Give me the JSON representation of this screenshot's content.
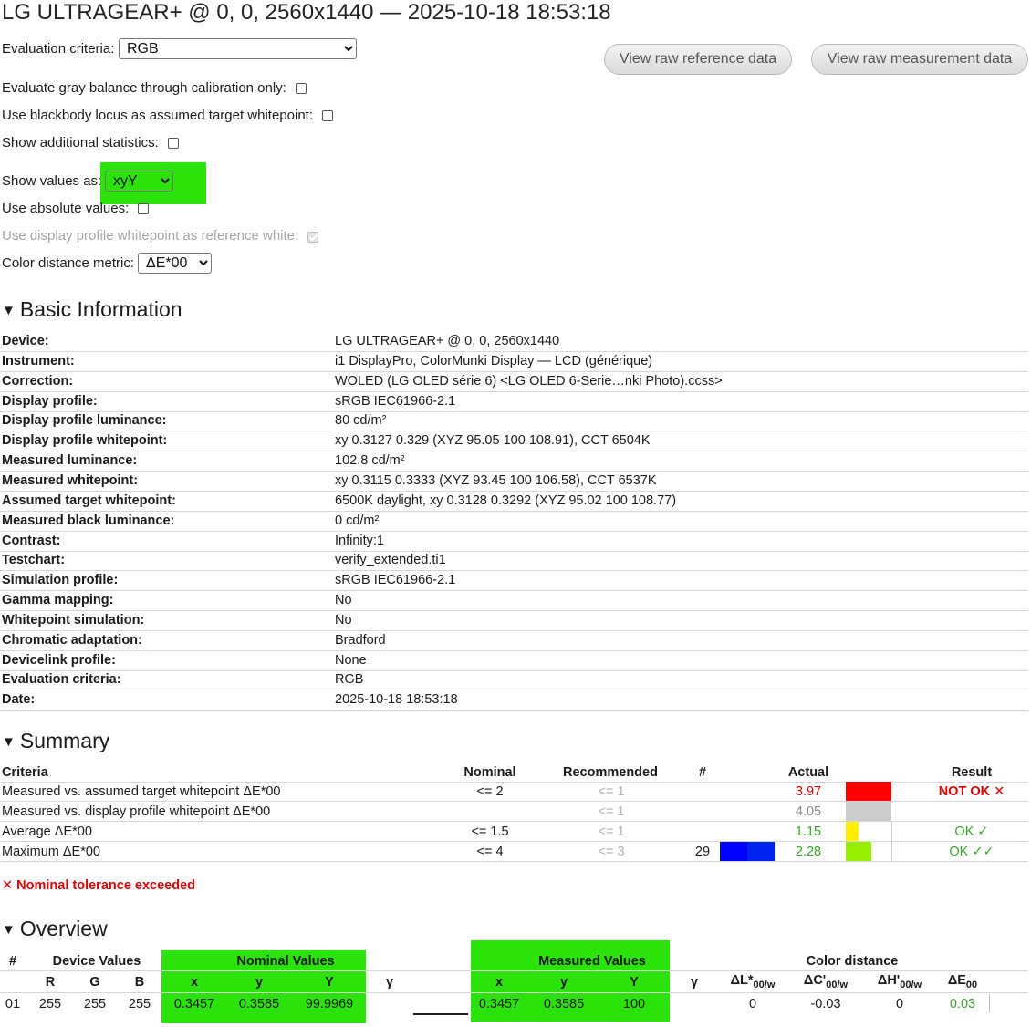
{
  "page": {
    "title": "LG ULTRAGEAR+ @ 0, 0, 2560x1440 — 2025-10-18 18:53:18"
  },
  "controls": {
    "evaluation_criteria": {
      "label": "Evaluation criteria:",
      "value": "RGB"
    },
    "view_raw_reference": "View raw reference data",
    "view_raw_measurement": "View raw measurement data",
    "gray_balance": {
      "label": "Evaluate gray balance through calibration only:",
      "checked": false
    },
    "blackbody": {
      "label": "Use blackbody locus as assumed target whitepoint:",
      "checked": false
    },
    "additional_stats": {
      "label": "Show additional statistics:",
      "checked": false
    },
    "show_values_as": {
      "label": "Show values as:",
      "value": "xyY"
    },
    "absolute_values": {
      "label": "Use absolute values:",
      "checked": false
    },
    "display_profile_whitepoint": {
      "label": "Use display profile whitepoint as reference white:",
      "checked": true,
      "disabled": true
    },
    "color_distance_metric": {
      "label": "Color distance metric:",
      "value": "ΔE*00"
    }
  },
  "basic_info": {
    "heading": "Basic Information",
    "rows": [
      {
        "key": "Device:",
        "value": "LG ULTRAGEAR+ @ 0, 0, 2560x1440"
      },
      {
        "key": "Instrument:",
        "value": "i1 DisplayPro, ColorMunki Display — LCD (générique)"
      },
      {
        "key": "Correction:",
        "value": "WOLED (LG OLED série 6) <LG OLED 6-Serie…nki Photo).ccss>"
      },
      {
        "key": "Display profile:",
        "value": "sRGB IEC61966-2.1"
      },
      {
        "key": "Display profile luminance:",
        "value": "80 cd/m²"
      },
      {
        "key": "Display profile whitepoint:",
        "value": "xy 0.3127 0.329 (XYZ 95.05 100 108.91), CCT 6504K"
      },
      {
        "key": "Measured luminance:",
        "value": "102.8 cd/m²"
      },
      {
        "key": "Measured whitepoint:",
        "value": "xy 0.3115 0.3333 (XYZ 93.45 100 106.58), CCT 6537K"
      },
      {
        "key": "Assumed target whitepoint:",
        "value": "6500K daylight, xy 0.3128 0.3292 (XYZ 95.02 100 108.77)"
      },
      {
        "key": "Measured black luminance:",
        "value": "0 cd/m²"
      },
      {
        "key": "Contrast:",
        "value": "Infinity:1"
      },
      {
        "key": "Testchart:",
        "value": "verify_extended.ti1"
      },
      {
        "key": "Simulation profile:",
        "value": "sRGB IEC61966-2.1"
      },
      {
        "key": "Gamma mapping:",
        "value": "No"
      },
      {
        "key": "Whitepoint simulation:",
        "value": "No"
      },
      {
        "key": "Chromatic adaptation:",
        "value": "Bradford"
      },
      {
        "key": "Devicelink profile:",
        "value": "None"
      },
      {
        "key": "Evaluation criteria:",
        "value": "RGB"
      },
      {
        "key": "Date:",
        "value": "2025-10-18 18:53:18"
      }
    ]
  },
  "summary": {
    "heading": "Summary",
    "headers": {
      "criteria": "Criteria",
      "nominal": "Nominal",
      "recommended": "Recommended",
      "count": "#",
      "actual": "Actual",
      "result": "Result"
    },
    "rows": [
      {
        "criteria": "Measured vs. assumed target whitepoint ΔE*00",
        "nominal": "<= 2",
        "recommended": "<= 1",
        "count": "",
        "actual": "3.97",
        "actual_color": "#e00000",
        "swatch": "#ff0000",
        "swatch_fraction": 1.0,
        "result": "NOT OK ✕",
        "result_color": "#e00000"
      },
      {
        "criteria": "Measured vs. display profile whitepoint ΔE*00",
        "nominal": "",
        "recommended": "<= 1",
        "count": "",
        "actual": "4.05",
        "actual_color": "#888888",
        "swatch": "#cccccc",
        "swatch_fraction": 1.0,
        "result": "",
        "result_color": "#888888"
      },
      {
        "criteria": "Average ΔE*00",
        "nominal": "<= 1.5",
        "recommended": "<= 1",
        "count": "",
        "actual": "1.15",
        "actual_color": "#3aa52a",
        "swatch": "#ffee00",
        "swatch_fraction": 0.29,
        "result": "OK ✓",
        "result_color": "#3aa52a"
      },
      {
        "criteria": "Maximum ΔE*00",
        "nominal": "<= 4",
        "recommended": "<= 3",
        "count": "29",
        "actual": "2.28",
        "actual_color": "#3aa52a",
        "swatch": "#99ee00",
        "swatch_fraction": 0.57,
        "result": "OK ✓✓",
        "result_color": "#3aa52a",
        "count_swatches": [
          "#0000ff",
          "#0022ee"
        ]
      }
    ],
    "warning": "✕ Nominal tolerance exceeded"
  },
  "overview": {
    "heading": "Overview",
    "group_headers": {
      "num": "#",
      "device": "Device Values",
      "nominal": "Nominal Values",
      "measured": "Measured Values",
      "color_distance": "Color distance"
    },
    "sub_headers": {
      "r": "R",
      "g": "G",
      "b": "B",
      "nx": "x",
      "ny": "y",
      "nY": "Y",
      "ngamma": "γ",
      "mx": "x",
      "my": "y",
      "mY": "Y",
      "mgamma": "γ",
      "dL": "ΔL*",
      "dL_sub": "00/w",
      "dC": "ΔC'",
      "dC_sub": "00/w",
      "dH": "ΔH'",
      "dH_sub": "00/w",
      "dE": "ΔE",
      "dE_sub": "00"
    },
    "rows": [
      {
        "num": "01",
        "r": "255",
        "g": "255",
        "b": "255",
        "nx": "0.3457",
        "ny": "0.3585",
        "nY": "99.9969",
        "mx": "0.3457",
        "my": "0.3585",
        "mY": "100",
        "dL": "0",
        "dC": "-0.03",
        "dH": "0",
        "dE": "0.03"
      }
    ]
  },
  "colors": {
    "highlight": "#2ce20b",
    "not_ok": "#e00000",
    "ok": "#3aa52a"
  }
}
